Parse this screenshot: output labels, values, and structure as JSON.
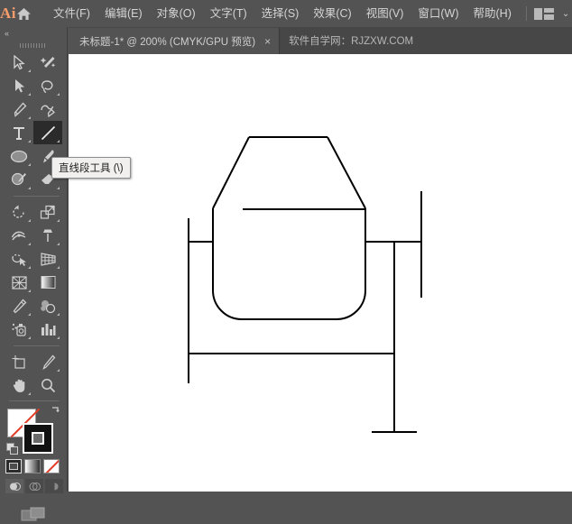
{
  "app": {
    "logo": "Ai",
    "home_icon": "home-icon"
  },
  "menubar": {
    "items": [
      {
        "label": "文件(F)",
        "name": "menu-file"
      },
      {
        "label": "编辑(E)",
        "name": "menu-edit"
      },
      {
        "label": "对象(O)",
        "name": "menu-object"
      },
      {
        "label": "文字(T)",
        "name": "menu-type"
      },
      {
        "label": "选择(S)",
        "name": "menu-select"
      },
      {
        "label": "效果(C)",
        "name": "menu-effect"
      },
      {
        "label": "视图(V)",
        "name": "menu-view"
      },
      {
        "label": "窗口(W)",
        "name": "menu-window"
      },
      {
        "label": "帮助(H)",
        "name": "menu-help"
      }
    ],
    "workspace_icon": "workspace-switcher-icon",
    "chevron": "⌄"
  },
  "tabbar": {
    "tab_title": "未标题-1* @ 200% (CMYK/GPU 预览)",
    "tab_close": "×",
    "watermark": "软件自学网：RJZXW.COM"
  },
  "toolbar": {
    "collapse": "«",
    "tools": [
      {
        "name": "selection-tool",
        "icon": "arrow-white"
      },
      {
        "name": "magic-wand-tool",
        "icon": "wand"
      },
      {
        "name": "direct-selection-tool",
        "icon": "arrow-solid"
      },
      {
        "name": "lasso-tool",
        "icon": "lasso"
      },
      {
        "name": "pen-tool",
        "icon": "pen"
      },
      {
        "name": "curvature-tool",
        "icon": "curvature"
      },
      {
        "name": "type-tool",
        "icon": "type"
      },
      {
        "name": "line-segment-tool",
        "icon": "line"
      },
      {
        "name": "ellipse-tool",
        "icon": "ellipse"
      },
      {
        "name": "paintbrush-tool",
        "icon": "brush"
      },
      {
        "name": "shaper-tool",
        "icon": "shaper"
      },
      {
        "name": "eraser-tool",
        "icon": "eraser"
      },
      {
        "name": "rotate-tool",
        "icon": "rotate"
      },
      {
        "name": "scale-tool",
        "icon": "scale"
      },
      {
        "name": "width-tool",
        "icon": "width"
      },
      {
        "name": "free-transform-tool",
        "icon": "pushpin"
      },
      {
        "name": "shape-builder-tool",
        "icon": "shape-builder"
      },
      {
        "name": "perspective-grid-tool",
        "icon": "perspective"
      },
      {
        "name": "mesh-tool",
        "icon": "mesh"
      },
      {
        "name": "gradient-tool",
        "icon": "gradient"
      },
      {
        "name": "eyedropper-tool",
        "icon": "eyedropper"
      },
      {
        "name": "blend-tool",
        "icon": "blend"
      },
      {
        "name": "symbol-sprayer-tool",
        "icon": "symbol-sprayer"
      },
      {
        "name": "column-graph-tool",
        "icon": "bar-chart"
      },
      {
        "name": "artboard-tool",
        "icon": "artboard"
      },
      {
        "name": "slice-tool",
        "icon": "knife"
      },
      {
        "name": "hand-tool",
        "icon": "hand"
      },
      {
        "name": "zoom-tool",
        "icon": "magnifier"
      }
    ],
    "selected_tool": "line-segment-tool",
    "fill_color": "#ffffff",
    "stroke_color": "#000000",
    "none_slash_color": "#e23b26",
    "swap_icon": "swap-fill-stroke-icon",
    "default_icon": "default-fill-stroke-icon",
    "color_modes": [
      {
        "name": "color-mode-solid",
        "icon": "solid-swatch"
      },
      {
        "name": "color-mode-gradient",
        "icon": "gradient-swatch"
      },
      {
        "name": "color-mode-none",
        "icon": "none-swatch"
      }
    ],
    "draw_modes": [
      {
        "name": "draw-normal-mode",
        "icon": "draw-normal"
      },
      {
        "name": "draw-behind-mode",
        "icon": "draw-behind"
      },
      {
        "name": "draw-inside-mode",
        "icon": "draw-inside"
      }
    ],
    "screen_mode": {
      "name": "change-screen-mode",
      "icon": "screen-mode-icon"
    }
  },
  "tooltip": {
    "text": "直线段工具 (\\)",
    "visible": true
  },
  "artwork": {
    "name": "cement-mixer-line-drawing",
    "stroke": "#000000",
    "stroke_width": 2,
    "description": "水泥搅拌机线稿",
    "zoom": "200%"
  },
  "colors": {
    "chrome_bg": "#535353",
    "tabbar_bg": "#474747",
    "canvas_bg": "#ffffff",
    "text": "#d4d4d4",
    "accent": "#f79c6a"
  }
}
